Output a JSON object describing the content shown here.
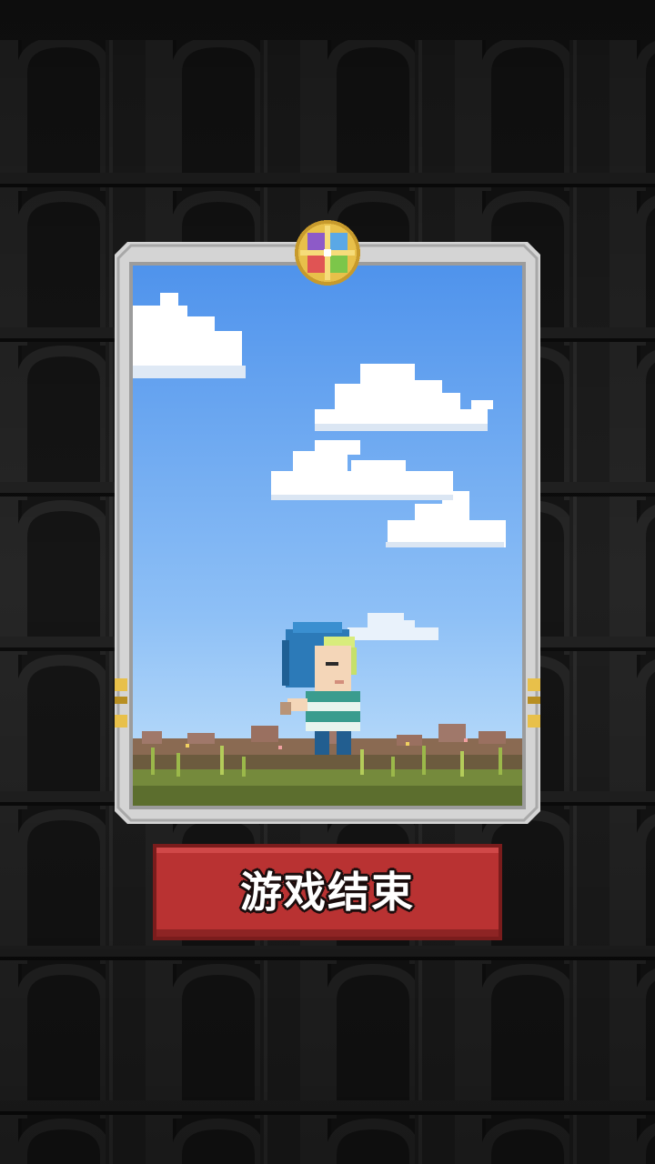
{
  "screen": {
    "background_color": "#161616",
    "arch_color": "#262626",
    "arch_shadow_color": "#0e0e0e"
  },
  "card": {
    "frame_color": "#d4d4d4",
    "frame_shadow_color": "#a8a8a8",
    "gold_color": "#e8c04a",
    "sky_top_color": "#4f93ec",
    "sky_bottom_color": "#b9dcfb",
    "emblem_icon": "four-color-shield-emblem-icon",
    "character_icon": "blue-hooded-hero-sprite-icon"
  },
  "button": {
    "game_over_label": "游戏结束",
    "color": "#b93232",
    "border_color": "#7a1c1c"
  }
}
